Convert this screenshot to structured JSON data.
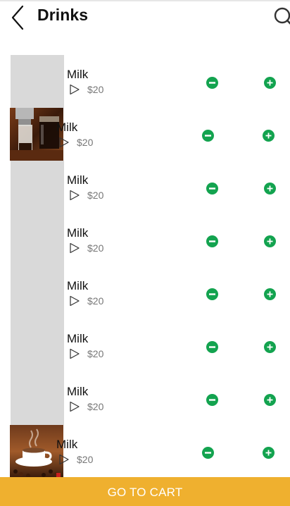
{
  "header": {
    "title": "Drinks"
  },
  "items": [
    {
      "name": "Milk",
      "price": "$20",
      "image": "placeholder"
    },
    {
      "name": "Milk",
      "price": "$20",
      "image": "iced-coffee-photo"
    },
    {
      "name": "Milk",
      "price": "$20",
      "image": "placeholder"
    },
    {
      "name": "Milk",
      "price": "$20",
      "image": "placeholder"
    },
    {
      "name": "Milk",
      "price": "$20",
      "image": "placeholder"
    },
    {
      "name": "Milk",
      "price": "$20",
      "image": "placeholder"
    },
    {
      "name": "Milk",
      "price": "$20",
      "image": "placeholder"
    },
    {
      "name": "Milk",
      "price": "$20",
      "image": "coffee-cup-photo"
    }
  ],
  "cart_button": {
    "label": "GO TO CART"
  },
  "colors": {
    "accent": "#13a34f",
    "cart": "#efb02f",
    "placeholder": "#d9d9d9",
    "price": "#777777"
  }
}
